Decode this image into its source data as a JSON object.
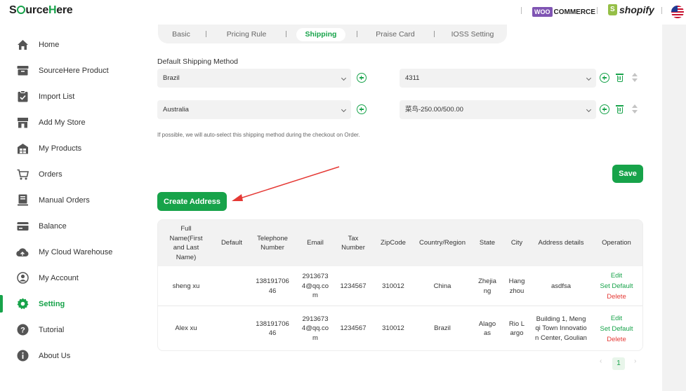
{
  "brand": {
    "logo_prefix": "S",
    "logo_mid": "urce",
    "logo_h": "H",
    "logo_suffix": "ere"
  },
  "platforms": {
    "woo_box": "WOO",
    "woo_text": "COMMERCE",
    "shopify": "shopify"
  },
  "sidebar": {
    "items": [
      {
        "label": "Home",
        "icon": "home-icon"
      },
      {
        "label": "SourceHere Product",
        "icon": "product-icon"
      },
      {
        "label": "Import List",
        "icon": "import-list-icon"
      },
      {
        "label": "Add My Store",
        "icon": "store-icon"
      },
      {
        "label": "My Products",
        "icon": "my-products-icon"
      },
      {
        "label": "Orders",
        "icon": "cart-icon"
      },
      {
        "label": "Manual Orders",
        "icon": "manual-orders-icon"
      },
      {
        "label": "Balance",
        "icon": "card-icon"
      },
      {
        "label": "My Cloud Warehouse",
        "icon": "cloud-icon"
      },
      {
        "label": "My Account",
        "icon": "user-icon"
      },
      {
        "label": "Setting",
        "icon": "gear-icon",
        "active": true
      },
      {
        "label": "Tutorial",
        "icon": "question-icon"
      },
      {
        "label": "About Us",
        "icon": "info-icon"
      }
    ]
  },
  "tabs": {
    "basic": "Basic",
    "pricing": "Pricing Rule",
    "shipping": "Shipping",
    "praise": "Praise Card",
    "ioss": "IOSS Setting",
    "active": "Shipping"
  },
  "shipping": {
    "label": "Default Shipping Method",
    "rows": [
      {
        "country": "Brazil",
        "method": "4311"
      },
      {
        "country": "Australia",
        "method": "菜鸟-250.00/500.00"
      }
    ],
    "hint": "If possible, we will auto-select this shipping method during the checkout on Order."
  },
  "buttons": {
    "save": "Save",
    "create_address": "Create Address"
  },
  "table": {
    "headers": {
      "full_name": "Full Name(First and Last Name)",
      "default": "Default",
      "telephone": "Telephone Number",
      "email": "Email",
      "tax": "Tax Number",
      "zip": "ZipCode",
      "country": "Country/Region",
      "state": "State",
      "city": "City",
      "address": "Address details",
      "operation": "Operation"
    },
    "rows": [
      {
        "full_name": "sheng xu",
        "default": "",
        "telephone": "13819170646",
        "email": "29136734@qq.com",
        "tax": "1234567",
        "zip": "310012",
        "country": "China",
        "state": "Zhejiang",
        "city": "Hangzhou",
        "address": "asdfsa"
      },
      {
        "full_name": "Alex xu",
        "default": "",
        "telephone": "13819170646",
        "email": "29136734@qq.com",
        "tax": "1234567",
        "zip": "310012",
        "country": "Brazil",
        "state": "Alagoas",
        "city": "Rio Largo",
        "address": "Building 1, Mengqi Town Innovation Center, Goulian"
      }
    ],
    "ops": {
      "edit": "Edit",
      "set_default": "Set Default",
      "delete": "Delete"
    }
  },
  "pagination": {
    "prev": "‹",
    "page": "1",
    "next": "›"
  },
  "colors": {
    "accent": "#17a34a",
    "danger": "#e53935",
    "arrow": "#e53935"
  }
}
